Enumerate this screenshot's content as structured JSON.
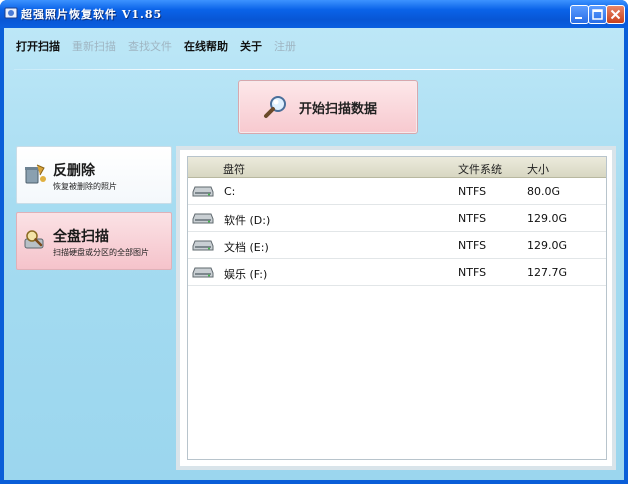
{
  "window": {
    "title": "超强照片恢复软件 V1.85"
  },
  "menu": {
    "items": [
      {
        "label": "打开扫描",
        "enabled": true
      },
      {
        "label": "重新扫描",
        "enabled": false
      },
      {
        "label": "查找文件",
        "enabled": false
      },
      {
        "label": "在线帮助",
        "enabled": true
      },
      {
        "label": "关于",
        "enabled": true
      },
      {
        "label": "注册",
        "enabled": false
      }
    ]
  },
  "scan": {
    "label": "开始扫描数据",
    "icon": "magnifier-icon"
  },
  "sidebar": {
    "undelete": {
      "title": "反删除",
      "desc": "恢复被删除的照片",
      "icon": "recycle-icon"
    },
    "fullscan": {
      "title": "全盘扫描",
      "desc": "扫描硬盘或分区的全部图片",
      "icon": "search-disk-icon"
    }
  },
  "table": {
    "headers": {
      "name": "盘符",
      "fs": "文件系统",
      "size": "大小"
    },
    "rows": [
      {
        "name": "C:",
        "fs": "NTFS",
        "size": "80.0G"
      },
      {
        "name": "软件 (D:)",
        "fs": "NTFS",
        "size": "129.0G"
      },
      {
        "name": "文档 (E:)",
        "fs": "NTFS",
        "size": "129.0G"
      },
      {
        "name": "娱乐 (F:)",
        "fs": "NTFS",
        "size": "127.7G"
      }
    ]
  },
  "colors": {
    "titlebar": "#0a5fe0",
    "client_bg": "#a6dcf1",
    "scan_button": "#f7c9cf",
    "active_side": "#f5c3cb"
  }
}
